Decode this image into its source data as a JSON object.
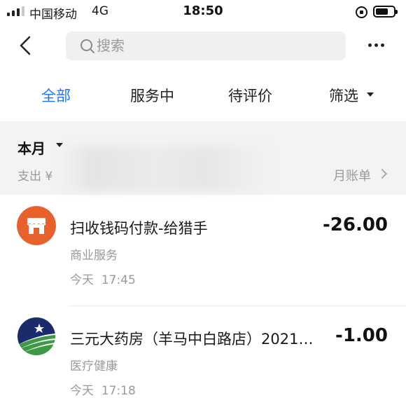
{
  "status_bar": {
    "carrier": "中国移动",
    "network": "4G",
    "time": "18:50"
  },
  "nav": {
    "search_placeholder": "搜索"
  },
  "tabs": [
    {
      "label": "全部",
      "active": true
    },
    {
      "label": "服务中",
      "active": false
    },
    {
      "label": "待评价",
      "active": false
    },
    {
      "label": "筛选",
      "active": false
    }
  ],
  "month_header": {
    "period": "本月",
    "spend_label": "支出 ¥",
    "monthly_bill": "月账单"
  },
  "transactions": [
    {
      "title": "扫收钱码付款-给猎手",
      "amount": "-26.00",
      "category": "商业服务",
      "date": "今天",
      "time": "17:45",
      "icon": "storefront-icon",
      "icon_color": "#e8612c"
    },
    {
      "title": "三元大药房（羊马中白路店）2021…",
      "amount": "-1.00",
      "category": "医疗健康",
      "date": "今天",
      "time": "17:18",
      "icon": "pharmacy-logo-icon",
      "icon_color": "#1b2a6b"
    }
  ],
  "colors": {
    "accent": "#1677ff",
    "secondary_text": "#9a9a9a",
    "header_bg": "#f3f3f3"
  }
}
